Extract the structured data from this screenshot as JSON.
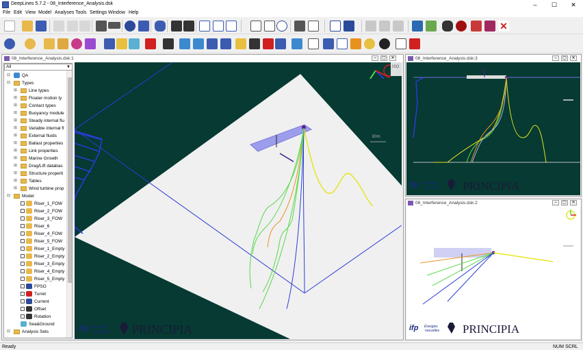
{
  "window": {
    "title": "DeepLines 5.7.2 - 08_Interference_Analysis.dsk"
  },
  "menu": [
    "File",
    "Edit",
    "View",
    "Model",
    "Analyses",
    "Tools",
    "Settings",
    "Window",
    "Help"
  ],
  "views": {
    "main": {
      "title": "08_Interference_Analysis.dsk:1",
      "scale_label": "80m",
      "iso_label": "ISO"
    },
    "top_right": {
      "title": "08_Interference_Analysis.dsk:3"
    },
    "bottom_right": {
      "title": "08_Interference_Analysis.dsk:2"
    }
  },
  "tree": {
    "filter": "All",
    "items": [
      {
        "label": "QA",
        "level": 1,
        "icon": "qa-icon"
      },
      {
        "label": "Types",
        "level": 1,
        "icon": "folder-icon"
      },
      {
        "label": "Line types",
        "level": 2,
        "icon": "folder-icon"
      },
      {
        "label": "Floater motion ty",
        "level": 2,
        "icon": "folder-icon"
      },
      {
        "label": "Contact types",
        "level": 2,
        "icon": "folder-icon"
      },
      {
        "label": "Buoyancy module",
        "level": 2,
        "icon": "folder-icon"
      },
      {
        "label": "Steady internal flu",
        "level": 2,
        "icon": "folder-icon"
      },
      {
        "label": "Variable internal fl",
        "level": 2,
        "icon": "folder-icon"
      },
      {
        "label": "External fluids",
        "level": 2,
        "icon": "folder-icon"
      },
      {
        "label": "Ballast properties",
        "level": 2,
        "icon": "folder-icon"
      },
      {
        "label": "Link properties",
        "level": 2,
        "icon": "folder-icon"
      },
      {
        "label": "Marine Growth",
        "level": 2,
        "icon": "folder-icon"
      },
      {
        "label": "Drag/Lift databas",
        "level": 2,
        "icon": "folder-icon"
      },
      {
        "label": "Structure properti",
        "level": 2,
        "icon": "folder-icon"
      },
      {
        "label": "Tables",
        "level": 2,
        "icon": "folder-icon"
      },
      {
        "label": "Wind turbine prop",
        "level": 2,
        "icon": "folder-icon"
      },
      {
        "label": "Model",
        "level": 1,
        "icon": "folder-icon"
      },
      {
        "label": "Riser_1_FOW",
        "level": 2,
        "icon": "riser-icon"
      },
      {
        "label": "Riser_2_FOW",
        "level": 2,
        "icon": "riser-icon"
      },
      {
        "label": "Riser_3_FOW",
        "level": 2,
        "icon": "riser-icon"
      },
      {
        "label": "Riser_6",
        "level": 2,
        "icon": "riser-icon"
      },
      {
        "label": "Riser_4_FOW",
        "level": 2,
        "icon": "riser-icon"
      },
      {
        "label": "Riser_5_FOW",
        "level": 2,
        "icon": "riser-icon"
      },
      {
        "label": "Riser_1_Empty",
        "level": 2,
        "icon": "riser-icon"
      },
      {
        "label": "Riser_2_Empty",
        "level": 2,
        "icon": "riser-icon"
      },
      {
        "label": "Riser_3_Empty",
        "level": 2,
        "icon": "riser-icon"
      },
      {
        "label": "Riser_4_Empty",
        "level": 2,
        "icon": "riser-icon"
      },
      {
        "label": "Riser_5_Empty",
        "level": 2,
        "icon": "riser-icon"
      },
      {
        "label": "FPSO",
        "level": 2,
        "icon": "fpso-icon"
      },
      {
        "label": "Turret",
        "level": 2,
        "icon": "turret-icon"
      },
      {
        "label": "Current",
        "level": 2,
        "icon": "current-icon"
      },
      {
        "label": "Offset",
        "level": 2,
        "icon": "offset-icon"
      },
      {
        "label": "Rotation",
        "level": 2,
        "icon": "rotation-icon"
      },
      {
        "label": "Sea&Ground",
        "level": 2,
        "icon": "seaground-icon"
      },
      {
        "label": "Analysis Sets",
        "level": 1,
        "icon": "folder-icon"
      }
    ]
  },
  "logos": {
    "ifp_top": "Énergies",
    "ifp_bottom": "nouvelles",
    "ifp_mark": "ifp",
    "principia": "PRINCIPIA"
  },
  "status": {
    "left": "Ready",
    "num": "NUM",
    "scrl": "SCRL"
  },
  "colors": {
    "viewport_bg": "#063a32",
    "seabed": "#f0f0f0",
    "blue_lines": "#2a3bd6",
    "yellow_riser": "#e6e620",
    "green_riser": "#56d84c",
    "orange_riser": "#e8921e"
  }
}
